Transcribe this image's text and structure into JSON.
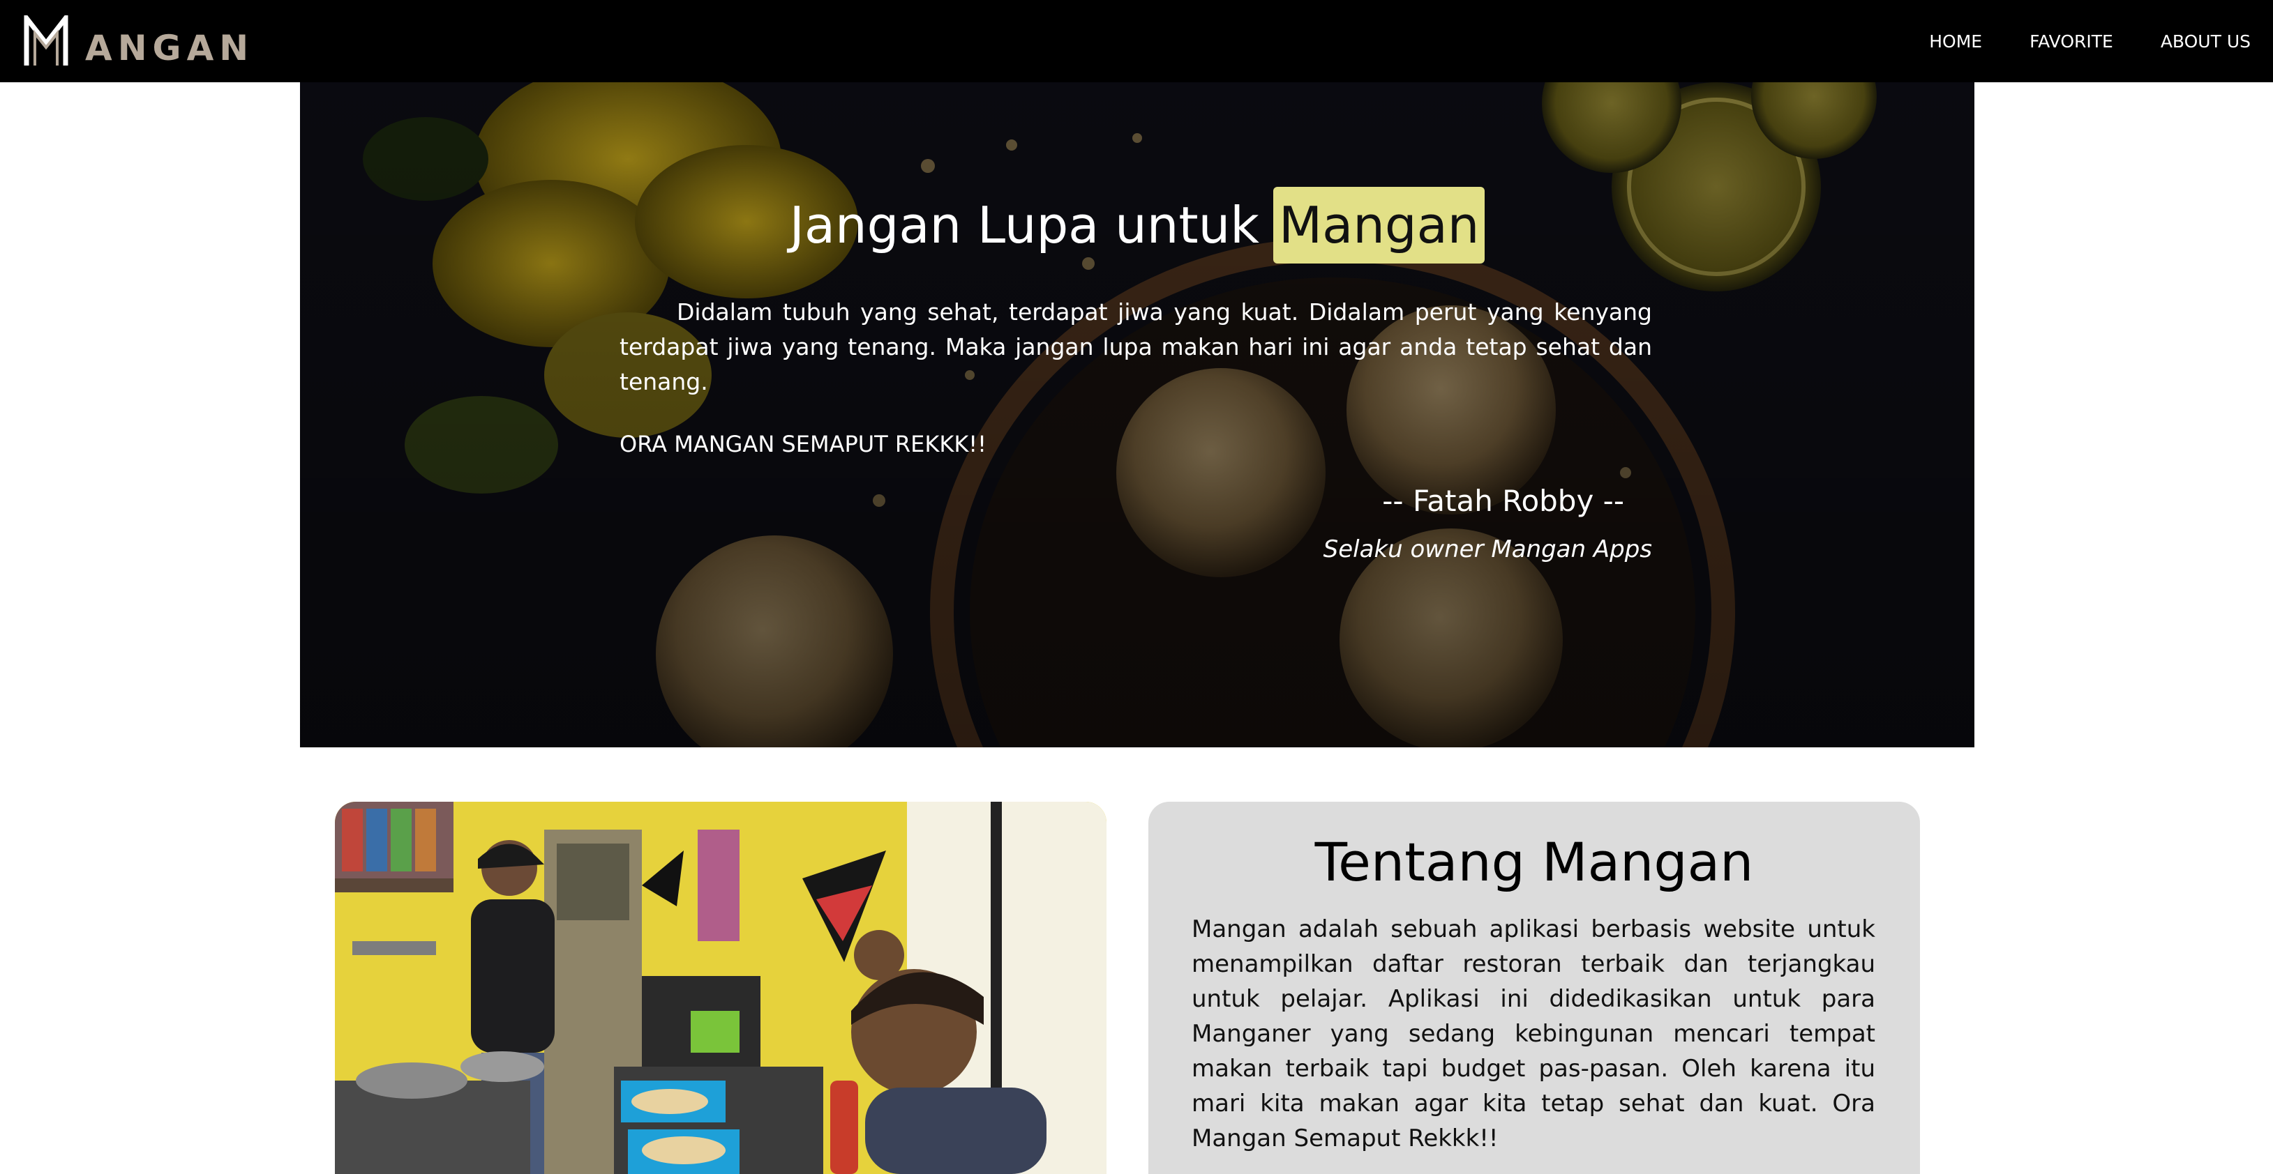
{
  "navbar": {
    "logo_text": "ANGAN",
    "links": [
      {
        "label": "HOME"
      },
      {
        "label": "FAVORITE"
      },
      {
        "label": "ABOUT US"
      }
    ]
  },
  "hero": {
    "title_prefix": "Jangan Lupa untuk",
    "title_highlight": "Mangan",
    "paragraph": "Didalam tubuh yang sehat, terdapat jiwa yang kuat. Didalam perut yang kenyang terdapat jiwa yang tenang. Maka jangan lupa makan hari ini agar anda tetap sehat dan tenang.",
    "shout": "ORA MANGAN SEMAPUT REKKK!!",
    "author": "-- Fatah Robby --",
    "role": "Selaku owner Mangan Apps"
  },
  "about": {
    "title": "Tentang Mangan",
    "text": "Mangan adalah sebuah aplikasi berbasis website untuk menampilkan daftar restoran terbaik dan terjangkau untuk pelajar. Aplikasi ini didedikasikan untuk para Manganer yang sedang kebingunan mencari tempat makan terbaik tapi budget pas-pasan. Oleh karena itu mari kita makan agar kita tetap sehat dan kuat. Ora Mangan Semaput Rekkk!!"
  },
  "colors": {
    "navbar_bg": "#000000",
    "logo_text": "#b6a99a",
    "highlight_bg": "#e2e087",
    "about_card_bg": "#dcdcdc"
  }
}
